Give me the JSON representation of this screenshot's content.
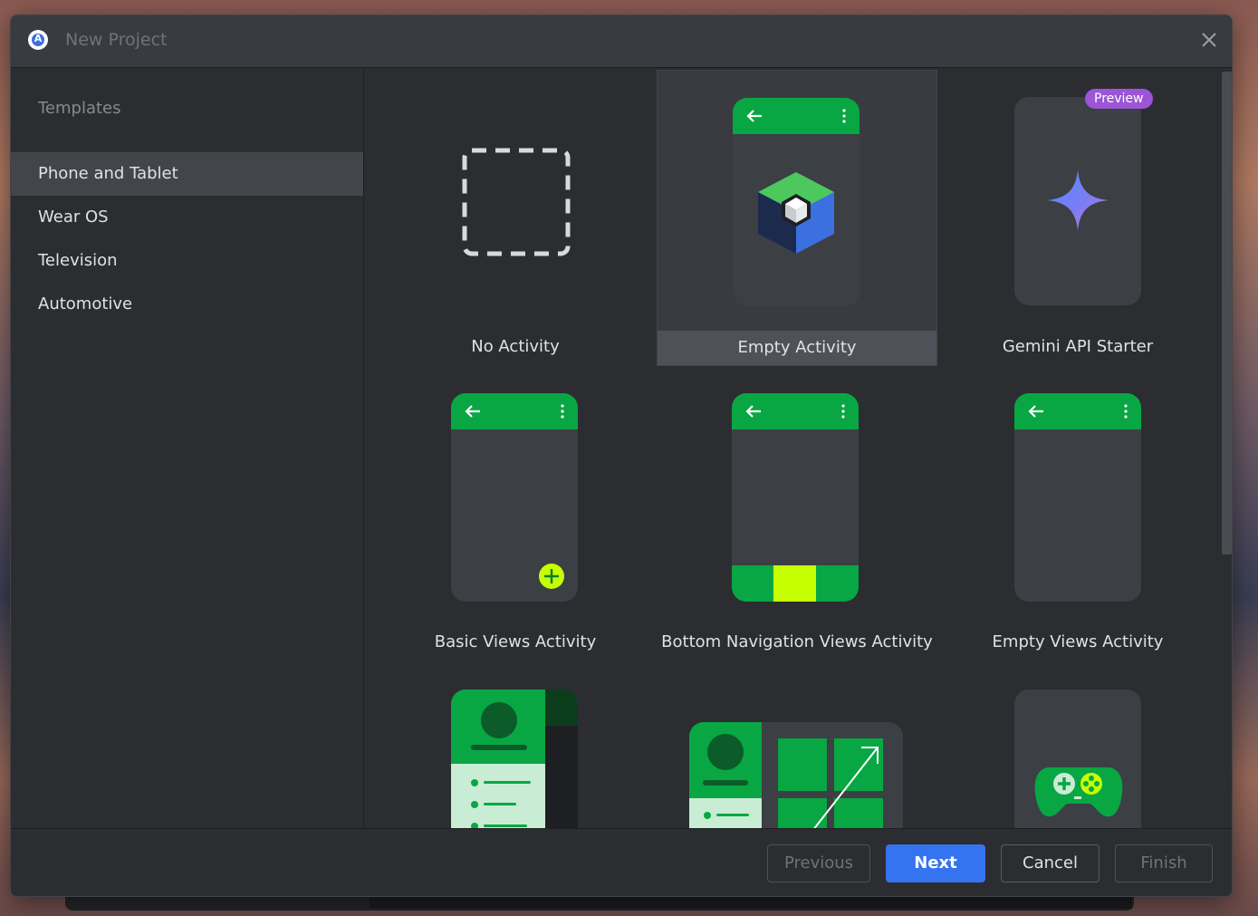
{
  "window": {
    "title": "New Project"
  },
  "sidebar": {
    "heading": "Templates",
    "items": [
      {
        "label": "Phone and Tablet"
      },
      {
        "label": "Wear OS"
      },
      {
        "label": "Television"
      },
      {
        "label": "Automotive"
      }
    ]
  },
  "templates": [
    {
      "label": "No Activity"
    },
    {
      "label": "Empty Activity"
    },
    {
      "label": "Gemini API Starter",
      "badge": "Preview"
    },
    {
      "label": "Basic Views Activity"
    },
    {
      "label": "Bottom Navigation Views Activity"
    },
    {
      "label": "Empty Views Activity"
    }
  ],
  "footer": {
    "previous": "Previous",
    "next": "Next",
    "cancel": "Cancel",
    "finish": "Finish"
  },
  "colors": {
    "accent": "#3574f0",
    "android_green": "#08a743",
    "lime": "#c6ff00",
    "preview": "#9b55d6"
  }
}
